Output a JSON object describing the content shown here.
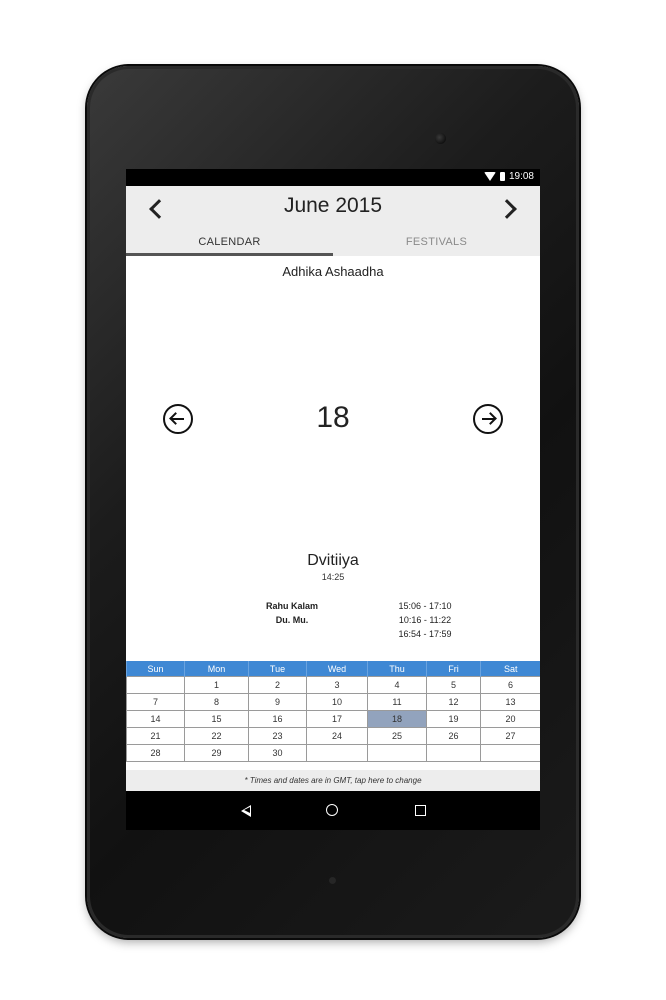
{
  "status": {
    "time": "19:08",
    "wifi_icon": "wifi-icon",
    "battery_icon": "battery-icon"
  },
  "header": {
    "title": "June 2015",
    "prev_icon": "chevron-left-icon",
    "next_icon": "chevron-right-icon",
    "tabs": [
      {
        "label": "CALENDAR",
        "active": true
      },
      {
        "label": "FESTIVALS",
        "active": false
      }
    ]
  },
  "day_view": {
    "lunar_month": "Adhika Ashaadha",
    "day_number": "18",
    "prev_icon": "circle-arrow-left-icon",
    "next_icon": "circle-arrow-right-icon",
    "tithi": "Dvitiiya",
    "tithi_time": "14:25",
    "timings": [
      {
        "label": "Rahu Kalam",
        "value": "15:06 - 17:10"
      },
      {
        "label": "Du. Mu.",
        "value": "10:16 - 11:22"
      },
      {
        "label": "",
        "value": "16:54 - 17:59"
      }
    ]
  },
  "calendar": {
    "weekdays": [
      "Sun",
      "Mon",
      "Tue",
      "Wed",
      "Thu",
      "Fri",
      "Sat"
    ],
    "weeks": [
      [
        "",
        "1",
        "2",
        "3",
        "4",
        "5",
        "6"
      ],
      [
        "7",
        "8",
        "9",
        "10",
        "11",
        "12",
        "13"
      ],
      [
        "14",
        "15",
        "16",
        "17",
        "18",
        "19",
        "20"
      ],
      [
        "21",
        "22",
        "23",
        "24",
        "25",
        "26",
        "27"
      ],
      [
        "28",
        "29",
        "30",
        "",
        "",
        "",
        ""
      ]
    ],
    "selected": "18",
    "header_color": "#3f88d4",
    "selected_color": "#92a3bd"
  },
  "footer_note": "* Times and dates are in GMT, tap here to change",
  "nav": {
    "back_icon": "back-icon",
    "home_icon": "home-icon",
    "recents_icon": "recents-icon"
  }
}
